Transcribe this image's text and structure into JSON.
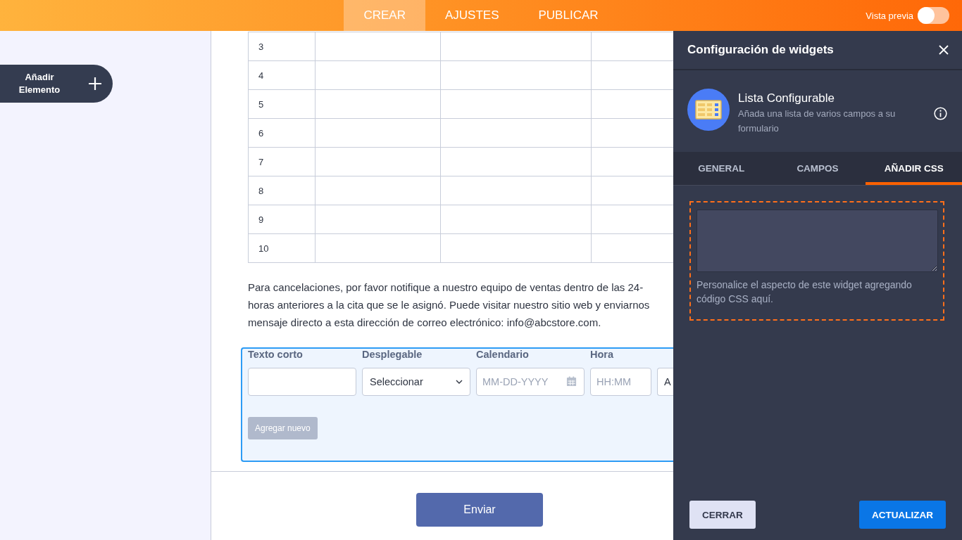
{
  "top_bar": {
    "tabs": [
      {
        "label": "CREAR",
        "selected": true
      },
      {
        "label": "AJUSTES",
        "selected": false
      },
      {
        "label": "PUBLICAR",
        "selected": false
      }
    ],
    "preview": {
      "label": "Vista previa",
      "on": false
    }
  },
  "sidebar": {
    "add_button": {
      "label": "Añadir Elemento"
    }
  },
  "table": {
    "rows": [
      {
        "number": "3"
      },
      {
        "number": "4"
      },
      {
        "number": "5"
      },
      {
        "number": "6"
      },
      {
        "number": "7"
      },
      {
        "number": "8"
      },
      {
        "number": "9"
      },
      {
        "number": "10"
      }
    ]
  },
  "paragraph": {
    "lines": [
      "Para cancelaciones, por favor notifique a nuestro equipo de ventas dentro de las 24-",
      "horas anteriores a la cita que se le asignó. Puede visitar nuestro sitio web y enviarnos",
      "mensaje directo a esta dirección de correo electrónico: info@abcstore.com."
    ]
  },
  "form": {
    "fields": [
      {
        "kind": "text",
        "label": "Texto corto"
      },
      {
        "kind": "select",
        "label": "Desplegable",
        "value": "Seleccionar"
      },
      {
        "kind": "date",
        "label": "Calendario",
        "placeholder": "MM-DD-YYYY"
      },
      {
        "kind": "time",
        "label": "Hora",
        "placeholder": "HH:MM"
      },
      {
        "kind": "clipped",
        "value": "A"
      }
    ],
    "add_button": {
      "label": "Agregar nuevo",
      "disabled": true
    }
  },
  "submit_button": {
    "label": "Enviar"
  },
  "panel": {
    "title": "Configuración de widgets",
    "widget": {
      "name": "Lista Configurable",
      "description": "Añada una lista de varios campos a su formulario"
    },
    "tabs": [
      {
        "label": "GENERAL",
        "selected": false
      },
      {
        "label": "CAMPOS",
        "selected": false
      },
      {
        "label": "AÑADIR CSS",
        "selected": true
      }
    ],
    "css_field": {
      "help": "Personalice el aspecto de este widget agregando código CSS aquí."
    },
    "buttons": [
      {
        "kind": "secondary",
        "label": "CERRAR"
      },
      {
        "kind": "primary",
        "label": "ACTUALIZAR"
      }
    ]
  }
}
